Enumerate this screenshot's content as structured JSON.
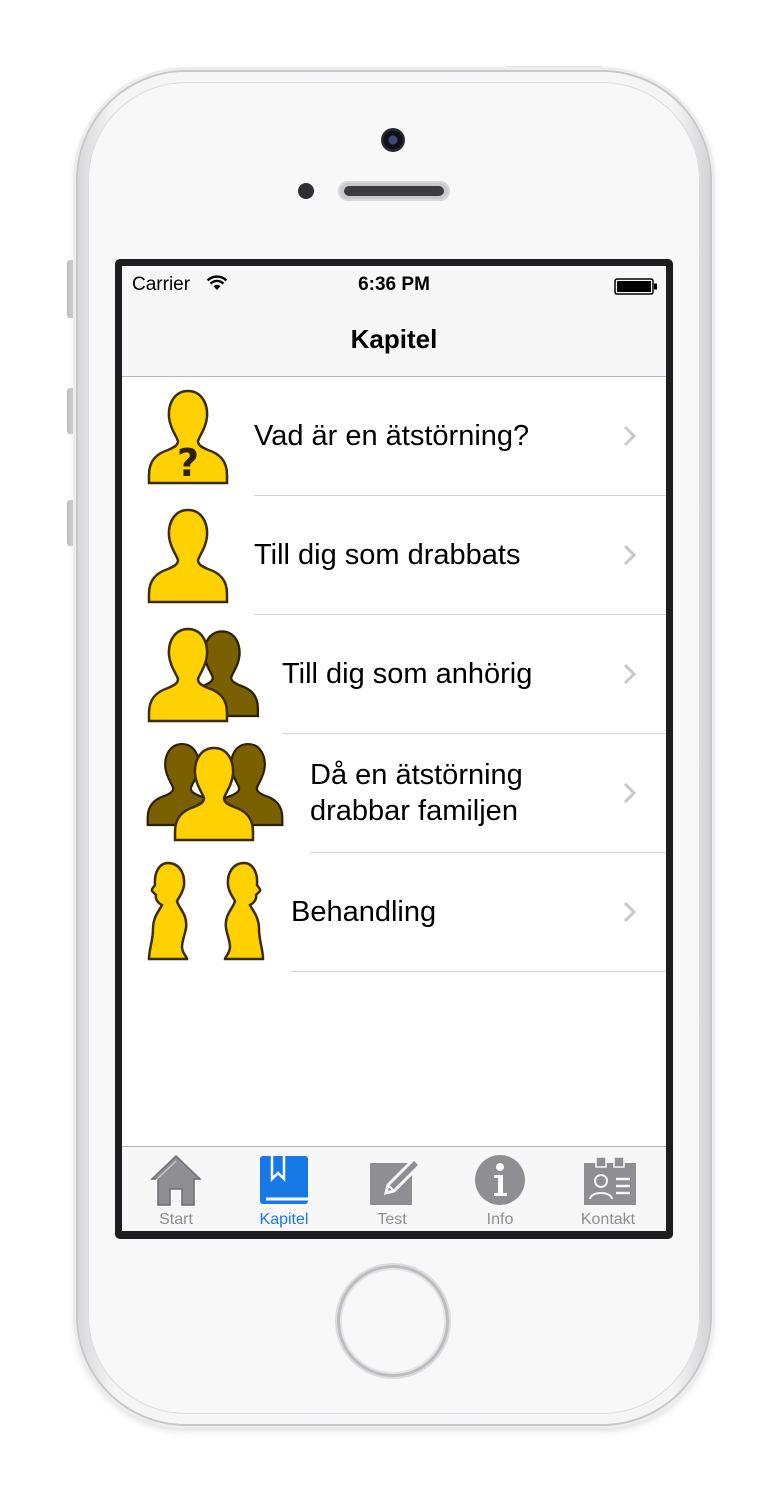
{
  "statusbar": {
    "carrier": "Carrier",
    "time": "6:36 PM"
  },
  "navbar": {
    "title": "Kapitel"
  },
  "chapters": [
    {
      "label": "Vad är en ätstörning?",
      "icon": "person-question-icon"
    },
    {
      "label": "Till dig som drabbats",
      "icon": "person-icon"
    },
    {
      "label": "Till dig som anhörig",
      "icon": "two-people-icon"
    },
    {
      "label": "Då en ätstörning drabbar familjen",
      "icon": "family-icon"
    },
    {
      "label": "Behandling",
      "icon": "two-profiles-icon"
    }
  ],
  "tabbar": {
    "active": "Kapitel",
    "tabs": [
      {
        "label": "Start",
        "icon": "house-icon"
      },
      {
        "label": "Kapitel",
        "icon": "bookmark-book-icon"
      },
      {
        "label": "Test",
        "icon": "pencil-note-icon"
      },
      {
        "label": "Info",
        "icon": "info-circle-icon"
      },
      {
        "label": "Kontakt",
        "icon": "contact-card-icon"
      }
    ]
  },
  "colors": {
    "figure_light": "#FFD100",
    "figure_dark": "#7A6000",
    "figure_outline": "#3A2E00",
    "tab_active": "#1679E6",
    "tab_inactive": "#8E8E93"
  }
}
